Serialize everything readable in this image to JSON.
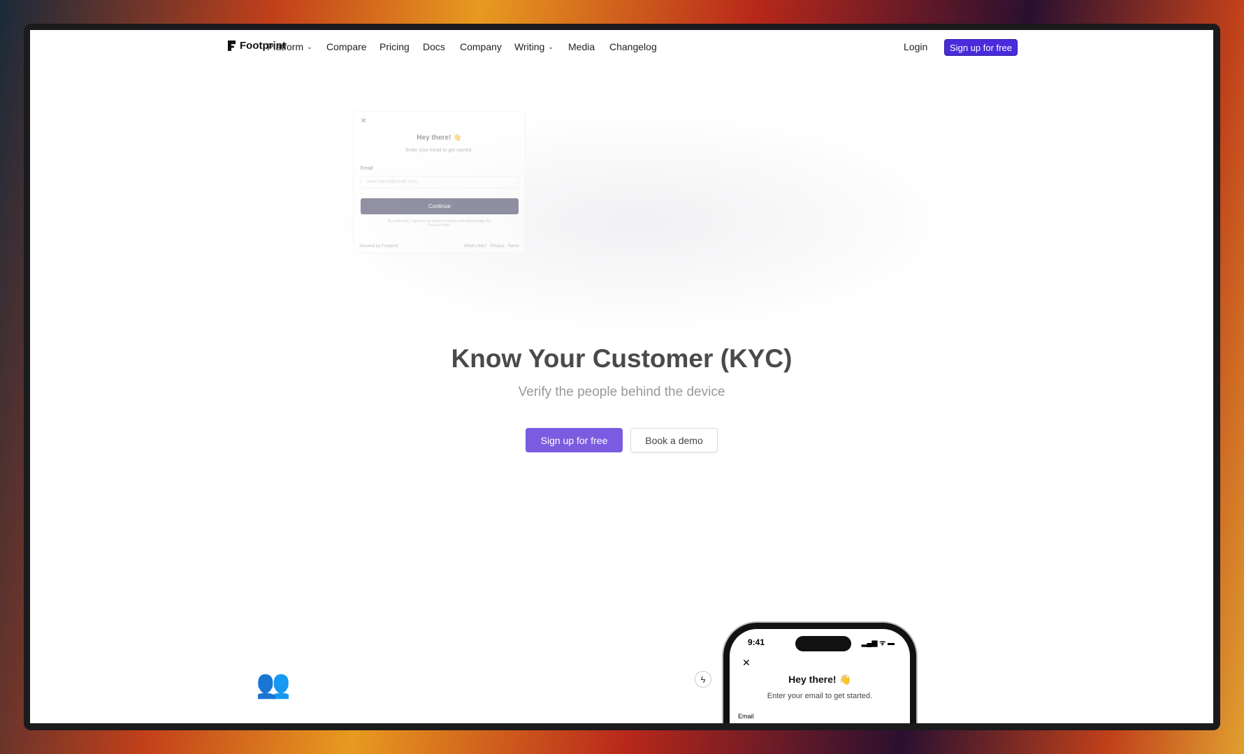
{
  "nav": {
    "brand": "Footprint",
    "items": [
      {
        "label": "Platform",
        "dropdown": true
      },
      {
        "label": "Compare"
      },
      {
        "label": "Pricing"
      },
      {
        "label": "Docs"
      },
      {
        "label": "Company"
      },
      {
        "label": "Writing",
        "dropdown": true
      },
      {
        "label": "Media"
      },
      {
        "label": "Changelog"
      }
    ],
    "login": "Login",
    "signup": "Sign up for free"
  },
  "card": {
    "title": "Hey there! 👋",
    "subtitle": "Enter your email to get started.",
    "email_label": "Email",
    "email_placeholder": "your.name@email.com",
    "continue": "Continue",
    "legal": "By continuing, I agree to our terms of service and acknowledge the Privacy Policy",
    "secured": "Secured by Footprint",
    "footer_links": "What's this? · Privacy · Terms"
  },
  "hero": {
    "title": "Know Your Customer (KYC)",
    "subtitle": "Verify the people behind the device",
    "primary": "Sign up for free",
    "secondary": "Book a demo"
  },
  "phone": {
    "time": "9:41",
    "status": "▂▄▆ ᯤ ▬",
    "title": "Hey there! 👋",
    "subtitle": "Enter your email to get started.",
    "email_label": "Email"
  },
  "colors": {
    "accent": "#4a2bdb",
    "cta": "#7b5ce0"
  }
}
